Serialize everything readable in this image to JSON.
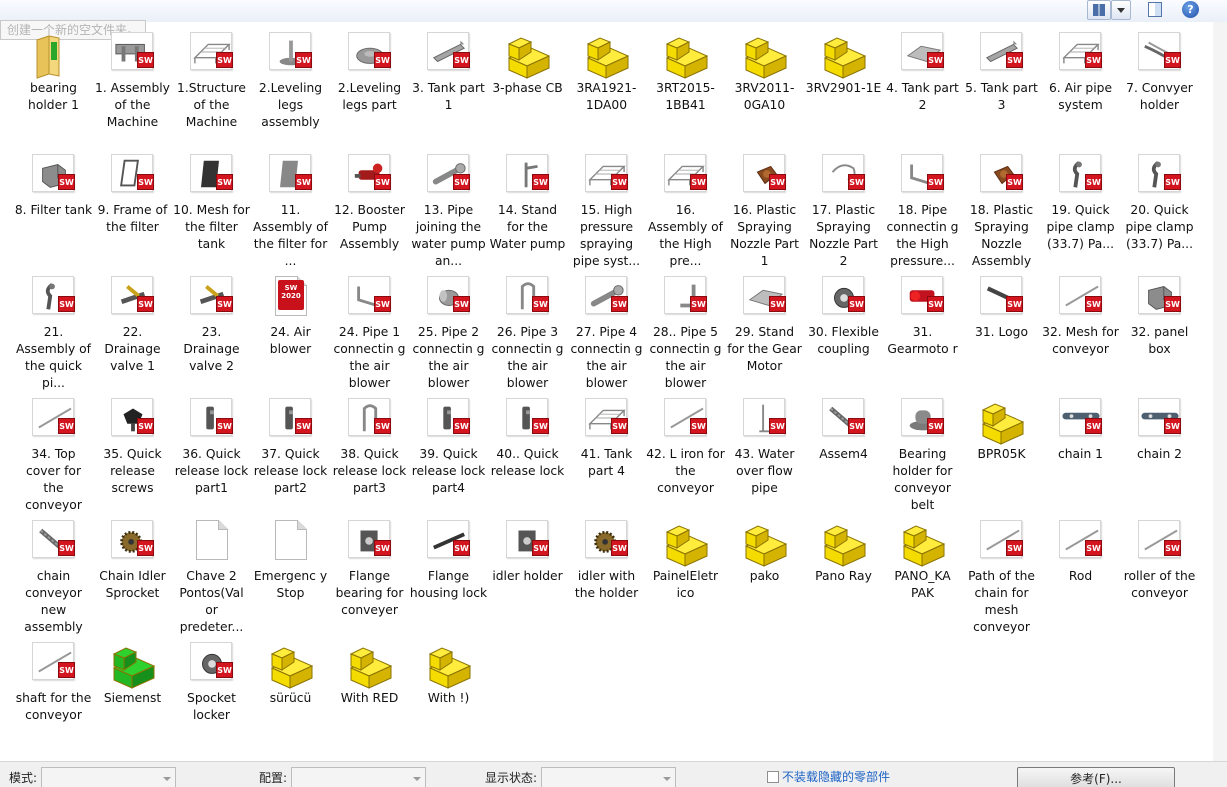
{
  "toolbar": {
    "help_glyph": "?",
    "tooltip": "创建一个新的空文件夹。",
    "icons": [
      "view-grid-icon",
      "chevron-down-icon",
      "preview-pane-icon",
      "help-icon"
    ]
  },
  "files": [
    {
      "label": "bearing holder 1",
      "icon": "folder"
    },
    {
      "label": "1. Assembly of the Machine",
      "icon": "sw",
      "art": "frame"
    },
    {
      "label": "1.Structure of the Machine",
      "icon": "sw",
      "art": "structure"
    },
    {
      "label": "2.Leveling legs assembly",
      "icon": "sw",
      "art": "foot"
    },
    {
      "label": "2.Leveling legs part",
      "icon": "sw",
      "art": "disk"
    },
    {
      "label": "3. Tank part 1",
      "icon": "sw",
      "art": "tank"
    },
    {
      "label": "3-phase CB",
      "icon": "block"
    },
    {
      "label": "3RA1921-1DA00",
      "icon": "block"
    },
    {
      "label": "3RT2015-1BB41",
      "icon": "block"
    },
    {
      "label": "3RV2011-0GA10",
      "icon": "block"
    },
    {
      "label": "3RV2901-1E",
      "icon": "block"
    },
    {
      "label": "4. Tank part 2",
      "icon": "sw",
      "art": "tray"
    },
    {
      "label": "5. Tank part 3",
      "icon": "sw",
      "art": "tank"
    },
    {
      "label": "6. Air pipe system",
      "icon": "sw",
      "art": "structure"
    },
    {
      "label": "7. Convyer holder",
      "icon": "sw",
      "art": "bar"
    },
    {
      "label": "8. Filter tank",
      "icon": "sw",
      "art": "box"
    },
    {
      "label": "9. Frame of the filter",
      "icon": "sw",
      "art": "frame-v"
    },
    {
      "label": "10. Mesh for the filter tank",
      "icon": "sw",
      "art": "panel-dark"
    },
    {
      "label": "11. Assembly of the filter for ...",
      "icon": "sw",
      "art": "panel"
    },
    {
      "label": "12. Booster Pump Assembly",
      "icon": "sw",
      "art": "pump"
    },
    {
      "label": "13. Pipe joining the water pump an...",
      "icon": "sw",
      "art": "pipe"
    },
    {
      "label": "14. Stand for the Water pump",
      "icon": "sw",
      "art": "stand"
    },
    {
      "label": "15. High pressure spraying pipe syst...",
      "icon": "sw",
      "art": "structure"
    },
    {
      "label": "16. Assembly of the High pre...",
      "icon": "sw",
      "art": "structure"
    },
    {
      "label": "16. Plastic Spraying Nozzle Part 1",
      "icon": "sw",
      "art": "nozzle"
    },
    {
      "label": "17. Plastic Spraying Nozzle Part 2",
      "icon": "sw",
      "art": "ring"
    },
    {
      "label": "18. Pipe connectin g the High pressure...",
      "icon": "sw",
      "art": "pipe-bend"
    },
    {
      "label": "18. Plastic Spraying Nozzle Assembly",
      "icon": "sw",
      "art": "nozzle"
    },
    {
      "label": "19. Quick pipe clamp (33.7) Pa...",
      "icon": "sw",
      "art": "clamp"
    },
    {
      "label": "20. Quick pipe clamp (33.7) Pa...",
      "icon": "sw",
      "art": "clamp"
    },
    {
      "label": "21. Assembly of the quick pi...",
      "icon": "sw",
      "art": "clamp"
    },
    {
      "label": "22. Drainage valve 1",
      "icon": "sw",
      "art": "valve"
    },
    {
      "label": "23. Drainage valve 2",
      "icon": "sw",
      "art": "valve"
    },
    {
      "label": "24. Air blower",
      "icon": "sw2020",
      "badge_year": "2020"
    },
    {
      "label": "24. Pipe 1 connectin g the air blower",
      "icon": "sw",
      "art": "pipe-bend"
    },
    {
      "label": "25. Pipe 2 connectin g the air blower",
      "icon": "sw",
      "art": "cyl"
    },
    {
      "label": "26. Pipe 3 connectin g the air blower",
      "icon": "sw",
      "art": "u-pipe"
    },
    {
      "label": "27. Pipe 4 connectin g the air blower",
      "icon": "sw",
      "art": "pipe"
    },
    {
      "label": "28.. Pipe 5 connectin g the air blower",
      "icon": "sw",
      "art": "l-pipe"
    },
    {
      "label": "29. Stand for the Gear Motor",
      "icon": "sw",
      "art": "tray"
    },
    {
      "label": "30. Flexible coupling",
      "icon": "sw",
      "art": "coupling"
    },
    {
      "label": "31. Gearmoto r",
      "icon": "sw",
      "art": "motor"
    },
    {
      "label": "31. Logo",
      "icon": "sw",
      "art": "logo-bar"
    },
    {
      "label": "32. Mesh for conveyor",
      "icon": "sw",
      "art": "rod"
    },
    {
      "label": "32. panel box",
      "icon": "sw",
      "art": "box"
    },
    {
      "label": "34. Top cover for the conveyor",
      "icon": "sw",
      "art": "rod"
    },
    {
      "label": "35. Quick release screws",
      "icon": "sw",
      "art": "knob"
    },
    {
      "label": "36. Quick release lock part1",
      "icon": "sw",
      "art": "latch"
    },
    {
      "label": "37. Quick release lock part2",
      "icon": "sw",
      "art": "latch"
    },
    {
      "label": "38. Quick release lock part3",
      "icon": "sw",
      "art": "u-pipe"
    },
    {
      "label": "39. Quick release lock part4",
      "icon": "sw",
      "art": "latch"
    },
    {
      "label": "40.. Quick release lock",
      "icon": "sw",
      "art": "latch"
    },
    {
      "label": "41. Tank part 4",
      "icon": "sw",
      "art": "structure"
    },
    {
      "label": "42. L iron for the conveyor",
      "icon": "sw",
      "art": "rod"
    },
    {
      "label": "43. Water over flow pipe",
      "icon": "sw",
      "art": "thin-pipe"
    },
    {
      "label": "Assem4",
      "icon": "sw",
      "art": "chain-diag"
    },
    {
      "label": "Bearing holder for conveyor belt",
      "icon": "sw",
      "art": "bearing"
    },
    {
      "label": "BPR05K",
      "icon": "block"
    },
    {
      "label": "chain 1",
      "icon": "sw",
      "art": "chain"
    },
    {
      "label": "chain 2",
      "icon": "sw",
      "art": "chain"
    },
    {
      "label": "chain conveyor new assembly",
      "icon": "sw",
      "art": "chain-diag"
    },
    {
      "label": "Chain Idler Sprocket",
      "icon": "sw",
      "art": "sprocket"
    },
    {
      "label": "Chave 2 Pontos(Val or predeter...",
      "icon": "blank"
    },
    {
      "label": "Emergenc y Stop",
      "icon": "blank"
    },
    {
      "label": "Flange bearing for conveyer",
      "icon": "sw",
      "art": "flange"
    },
    {
      "label": "Flange housing lock",
      "icon": "sw",
      "art": "rod-dark"
    },
    {
      "label": "idler holder",
      "icon": "sw",
      "art": "flange"
    },
    {
      "label": "idler with the holder",
      "icon": "sw",
      "art": "sprocket"
    },
    {
      "label": "PainelEletr ico",
      "icon": "block"
    },
    {
      "label": "pako",
      "icon": "block"
    },
    {
      "label": "Pano Ray",
      "icon": "block"
    },
    {
      "label": "PANO_KA PAK",
      "icon": "block"
    },
    {
      "label": "Path of the chain for mesh conveyor",
      "icon": "sw",
      "art": "rod"
    },
    {
      "label": "Rod",
      "icon": "sw",
      "art": "rod"
    },
    {
      "label": "roller of the conveyor",
      "icon": "sw",
      "art": "rod"
    },
    {
      "label": "shaft for the conveyor",
      "icon": "sw",
      "art": "rod"
    },
    {
      "label": "Siemenst",
      "icon": "block-green"
    },
    {
      "label": "Spocket locker",
      "icon": "sw",
      "art": "coupling"
    },
    {
      "label": "sürücü",
      "icon": "block"
    },
    {
      "label": "With  RED",
      "icon": "block"
    },
    {
      "label": "With !)",
      "icon": "block"
    }
  ],
  "status_bar": {
    "mode_label": "模式:",
    "config_label": "配置:",
    "display_label": "显示状态:",
    "hidden_components_label": "不装载隐藏的零部件",
    "reference_button": "参考(F)...",
    "link_color": "#1c62c5"
  },
  "colors": {
    "sw_badge": "#d2151f",
    "block_yellow": "#f5dc00",
    "block_green": "#22b322",
    "folder": "#e8c35a"
  }
}
